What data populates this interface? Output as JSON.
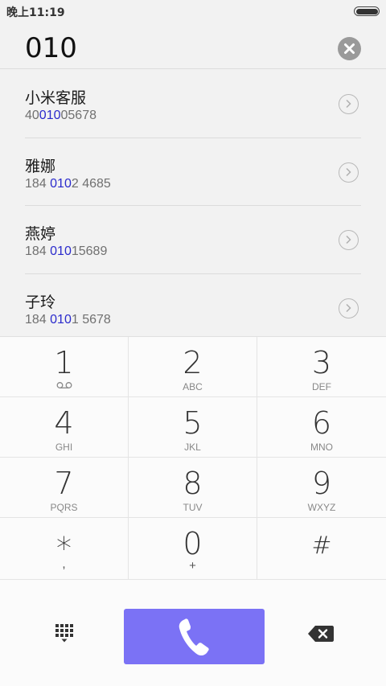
{
  "status_bar": {
    "time": "晚上11:19"
  },
  "dialer": {
    "dialed_number": "010"
  },
  "results": [
    {
      "name": "小米客服",
      "number_before": "40",
      "number_match": "010",
      "number_after": "05678"
    },
    {
      "name": "雅娜",
      "number_before": "184 ",
      "number_match": "010",
      "number_after": "2 4685"
    },
    {
      "name": "燕婷",
      "number_before": "184 ",
      "number_match": "010",
      "number_after": "15689"
    },
    {
      "name": "子玲",
      "number_before": "184 ",
      "number_match": "010",
      "number_after": "1 5678"
    }
  ],
  "keypad": {
    "keys": [
      {
        "digit": "1",
        "letters": ""
      },
      {
        "digit": "2",
        "letters": "ABC"
      },
      {
        "digit": "3",
        "letters": "DEF"
      },
      {
        "digit": "4",
        "letters": "GHI"
      },
      {
        "digit": "5",
        "letters": "JKL"
      },
      {
        "digit": "6",
        "letters": "MNO"
      },
      {
        "digit": "7",
        "letters": "PQRS"
      },
      {
        "digit": "8",
        "letters": "TUV"
      },
      {
        "digit": "9",
        "letters": "WXYZ"
      },
      {
        "digit": "*",
        "letters": ","
      },
      {
        "digit": "0",
        "letters": "+"
      },
      {
        "digit": "#",
        "letters": ""
      }
    ]
  },
  "colors": {
    "accent": "#7b72f5",
    "highlight": "#2b2bcc"
  },
  "icons": {
    "voicemail": "voicemail-icon",
    "clear": "clear-icon",
    "detail": "chevron-right-icon",
    "keypad_toggle": "dialpad-icon",
    "call": "phone-icon",
    "backspace": "backspace-icon"
  }
}
